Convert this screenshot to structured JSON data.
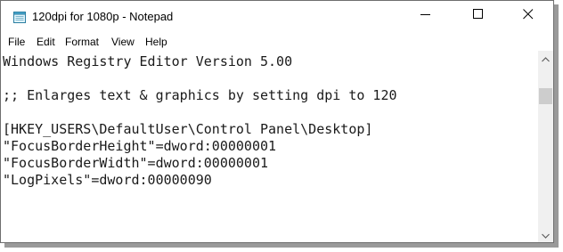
{
  "window": {
    "title": "120dpi for 1080p - Notepad",
    "icon": "notepad-icon",
    "controls": {
      "minimize": "minimize-icon",
      "maximize": "maximize-icon",
      "close": "close-icon"
    }
  },
  "menu": {
    "items": [
      "File",
      "Edit",
      "Format",
      "View",
      "Help"
    ]
  },
  "editor": {
    "lines": [
      "Windows Registry Editor Version 5.00",
      "",
      ";; Enlarges text & graphics by setting dpi to 120",
      "",
      "[HKEY_USERS\\DefaultUser\\Control Panel\\Desktop]",
      "\"FocusBorderHeight\"=dword:00000001",
      "\"FocusBorderWidth\"=dword:00000001",
      "\"LogPixels\"=dword:00000090"
    ]
  },
  "scrollbar": {
    "up_icon": "chevron-up-icon",
    "down_icon": "chevron-down-icon"
  },
  "colors": {
    "background": "#ffffff",
    "text": "#1a1a1a",
    "border": "#6f6f6f",
    "scrollbar_track": "#f0f0f0",
    "scrollbar_thumb": "#cdcdcd"
  }
}
